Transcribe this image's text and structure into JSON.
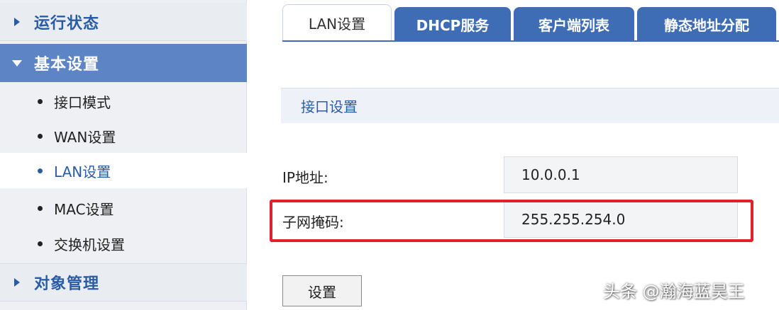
{
  "sidebar": {
    "groups": [
      {
        "label": "运行状态"
      },
      {
        "label": "基本设置"
      },
      {
        "label": "对象管理"
      }
    ],
    "items": [
      {
        "label": "接口模式"
      },
      {
        "label": "WAN设置"
      },
      {
        "label": "LAN设置"
      },
      {
        "label": "MAC设置"
      },
      {
        "label": "交换机设置"
      }
    ]
  },
  "tabs": [
    {
      "label": "LAN设置"
    },
    {
      "label": "DHCP服务"
    },
    {
      "label": "客户端列表"
    },
    {
      "label": "静态地址分配"
    }
  ],
  "section": {
    "title": "接口设置"
  },
  "fields": {
    "ip": {
      "label": "IP地址:",
      "value": "10.0.0.1"
    },
    "mask": {
      "label": "子网掩码:",
      "value": "255.255.254.0"
    }
  },
  "buttons": {
    "set": "设置"
  },
  "watermark": "头条 @瀚海蓝昊王",
  "colors": {
    "accent": "#3f6db5",
    "highlight": "#e0202a",
    "active_group": "#5d84c4"
  }
}
